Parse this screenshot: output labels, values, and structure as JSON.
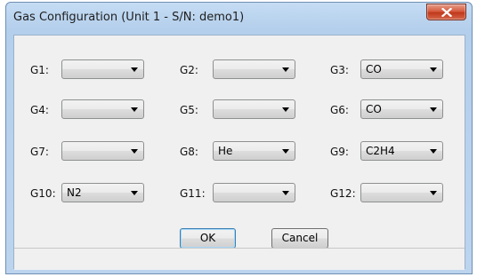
{
  "window": {
    "title": "Gas Configuration (Unit 1 - S/N: demo1)"
  },
  "gases": [
    {
      "label": "G1:",
      "value": ""
    },
    {
      "label": "G2:",
      "value": ""
    },
    {
      "label": "G3:",
      "value": "CO"
    },
    {
      "label": "G4:",
      "value": ""
    },
    {
      "label": "G5:",
      "value": ""
    },
    {
      "label": "G6:",
      "value": "CO"
    },
    {
      "label": "G7:",
      "value": ""
    },
    {
      "label": "G8:",
      "value": "He"
    },
    {
      "label": "G9:",
      "value": "C2H4"
    },
    {
      "label": "G10:",
      "value": "N2"
    },
    {
      "label": "G11:",
      "value": ""
    },
    {
      "label": "G12:",
      "value": ""
    }
  ],
  "buttons": {
    "ok_label": "OK",
    "cancel_label": "Cancel"
  },
  "icons": {
    "close": "close-icon",
    "dropdown": "chevron-down-icon"
  }
}
